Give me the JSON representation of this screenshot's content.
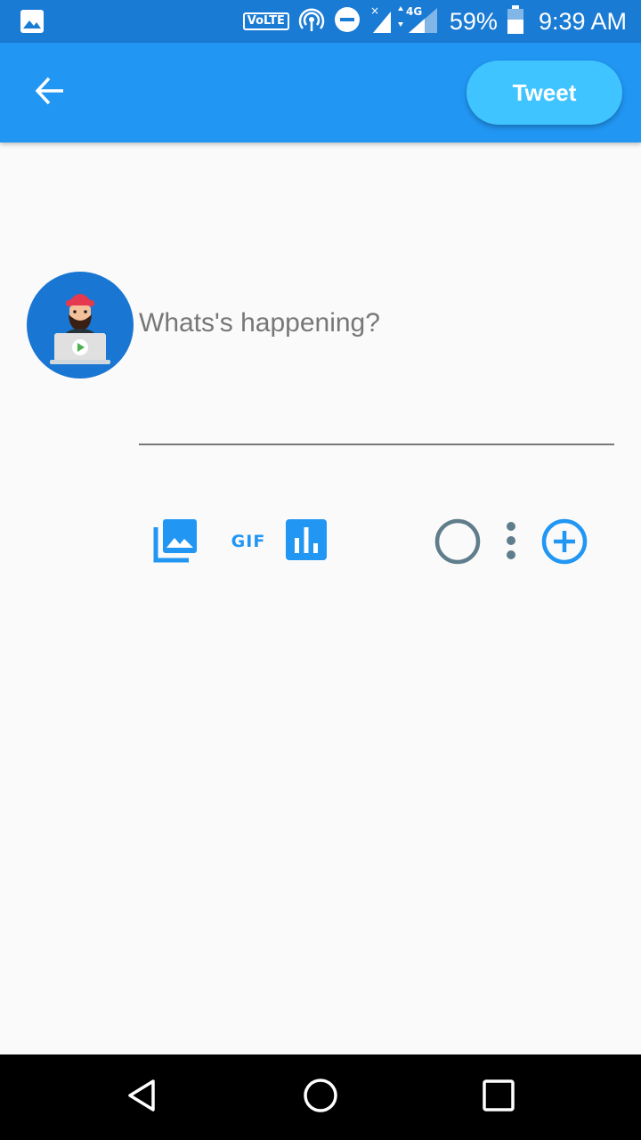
{
  "status_bar": {
    "network_label": "VoLTE",
    "network_type": "4G",
    "battery": "59%",
    "time": "9:39 AM",
    "icons": [
      "image-notification-icon",
      "hotspot-icon",
      "do-not-disturb-icon",
      "signal-icon",
      "battery-icon"
    ]
  },
  "app_bar": {
    "back_icon": "arrow-back-icon",
    "tweet_label": "Tweet"
  },
  "compose": {
    "placeholder": "Whats's happening?",
    "value": ""
  },
  "toolbar": {
    "icons": [
      "photo-library-icon",
      "gif-icon",
      "poll-icon",
      "progress-circle-icon",
      "more-vert-icon",
      "add-circle-icon"
    ],
    "gif_label": "GIF"
  },
  "colors": {
    "status_bar": "#1a7bd4",
    "app_bar": "#2196f3",
    "tweet_button": "#40c4ff",
    "accent": "#2196f3",
    "muted_icon": "#607d8b",
    "background": "#fafafa"
  },
  "nav_bar": {
    "icons": [
      "back-triangle-icon",
      "home-circle-icon",
      "recents-square-icon"
    ]
  }
}
